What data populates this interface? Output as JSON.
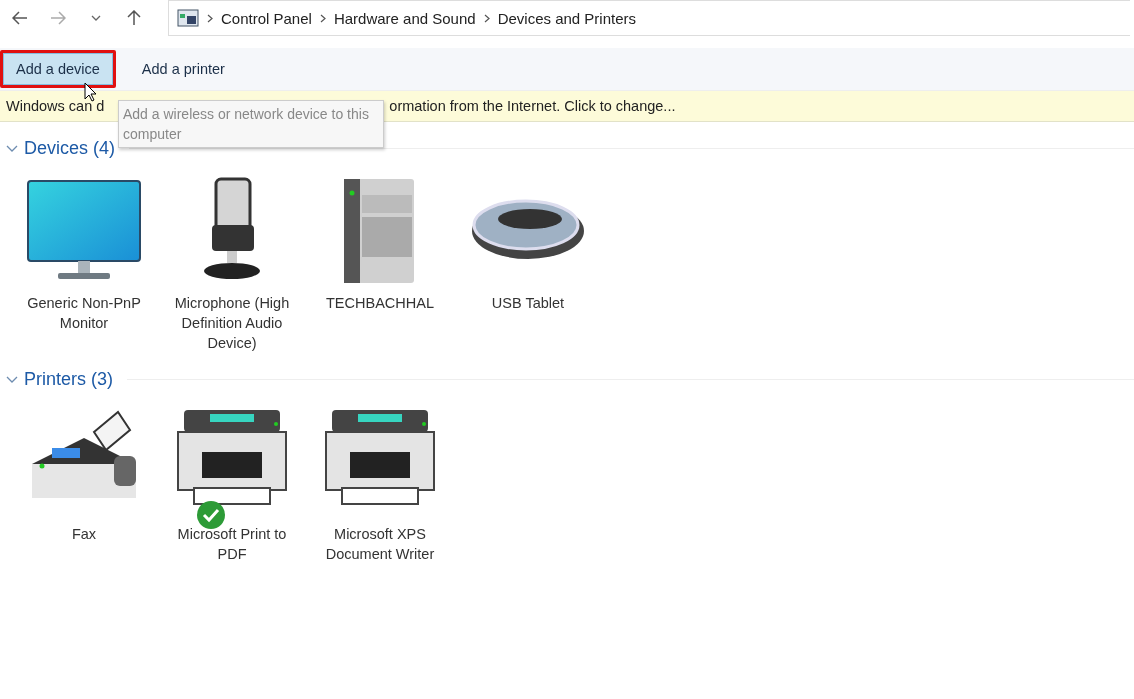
{
  "nav": {
    "breadcrumb": [
      "Control Panel",
      "Hardware and Sound",
      "Devices and Printers"
    ]
  },
  "toolbar": {
    "buttons": [
      {
        "label": "Add a device",
        "highlighted": true
      },
      {
        "label": "Add a printer",
        "highlighted": false
      }
    ]
  },
  "infobar": {
    "text_before": "Windows can d",
    "text_after": "ormation from the Internet. Click to change..."
  },
  "tooltip": {
    "text": "Add a wireless or network device to this computer"
  },
  "groups": [
    {
      "title": "Devices (4)",
      "expanded": true,
      "items": [
        {
          "kind": "monitor",
          "label": "Generic Non-PnP Monitor",
          "default": false
        },
        {
          "kind": "microphone",
          "label": "Microphone (High Definition Audio Device)",
          "default": false
        },
        {
          "kind": "computer",
          "label": "TECHBACHHAL",
          "default": false
        },
        {
          "kind": "mouse",
          "label": "USB Tablet",
          "default": false
        }
      ]
    },
    {
      "title": "Printers (3)",
      "expanded": true,
      "items": [
        {
          "kind": "fax",
          "label": "Fax",
          "default": false
        },
        {
          "kind": "printer",
          "label": "Microsoft Print to PDF",
          "default": true
        },
        {
          "kind": "printer",
          "label": "Microsoft XPS Document Writer",
          "default": false
        }
      ]
    }
  ]
}
